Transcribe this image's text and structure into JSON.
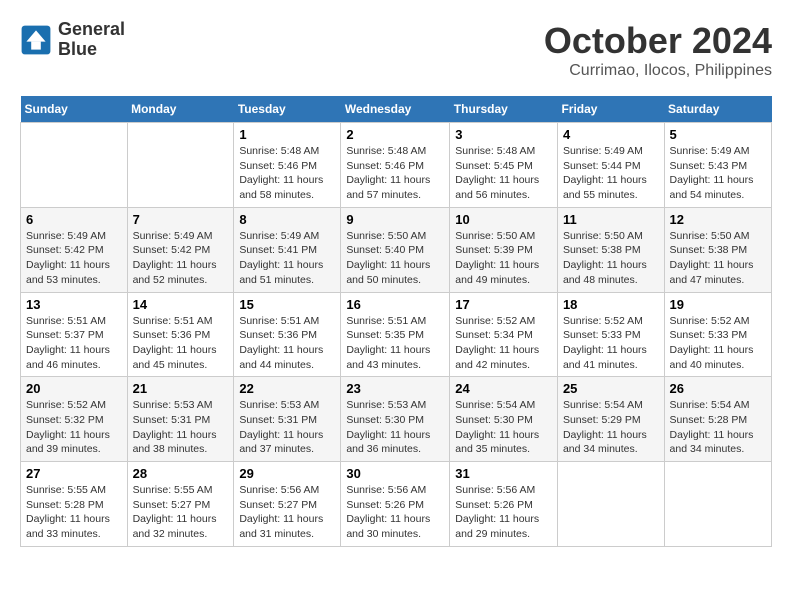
{
  "logo": {
    "line1": "General",
    "line2": "Blue"
  },
  "title": "October 2024",
  "subtitle": "Currimao, Ilocos, Philippines",
  "weekdays": [
    "Sunday",
    "Monday",
    "Tuesday",
    "Wednesday",
    "Thursday",
    "Friday",
    "Saturday"
  ],
  "weeks": [
    [
      {
        "day": "",
        "sunrise": "",
        "sunset": "",
        "daylight": ""
      },
      {
        "day": "",
        "sunrise": "",
        "sunset": "",
        "daylight": ""
      },
      {
        "day": "1",
        "sunrise": "Sunrise: 5:48 AM",
        "sunset": "Sunset: 5:46 PM",
        "daylight": "Daylight: 11 hours and 58 minutes."
      },
      {
        "day": "2",
        "sunrise": "Sunrise: 5:48 AM",
        "sunset": "Sunset: 5:46 PM",
        "daylight": "Daylight: 11 hours and 57 minutes."
      },
      {
        "day": "3",
        "sunrise": "Sunrise: 5:48 AM",
        "sunset": "Sunset: 5:45 PM",
        "daylight": "Daylight: 11 hours and 56 minutes."
      },
      {
        "day": "4",
        "sunrise": "Sunrise: 5:49 AM",
        "sunset": "Sunset: 5:44 PM",
        "daylight": "Daylight: 11 hours and 55 minutes."
      },
      {
        "day": "5",
        "sunrise": "Sunrise: 5:49 AM",
        "sunset": "Sunset: 5:43 PM",
        "daylight": "Daylight: 11 hours and 54 minutes."
      }
    ],
    [
      {
        "day": "6",
        "sunrise": "Sunrise: 5:49 AM",
        "sunset": "Sunset: 5:42 PM",
        "daylight": "Daylight: 11 hours and 53 minutes."
      },
      {
        "day": "7",
        "sunrise": "Sunrise: 5:49 AM",
        "sunset": "Sunset: 5:42 PM",
        "daylight": "Daylight: 11 hours and 52 minutes."
      },
      {
        "day": "8",
        "sunrise": "Sunrise: 5:49 AM",
        "sunset": "Sunset: 5:41 PM",
        "daylight": "Daylight: 11 hours and 51 minutes."
      },
      {
        "day": "9",
        "sunrise": "Sunrise: 5:50 AM",
        "sunset": "Sunset: 5:40 PM",
        "daylight": "Daylight: 11 hours and 50 minutes."
      },
      {
        "day": "10",
        "sunrise": "Sunrise: 5:50 AM",
        "sunset": "Sunset: 5:39 PM",
        "daylight": "Daylight: 11 hours and 49 minutes."
      },
      {
        "day": "11",
        "sunrise": "Sunrise: 5:50 AM",
        "sunset": "Sunset: 5:38 PM",
        "daylight": "Daylight: 11 hours and 48 minutes."
      },
      {
        "day": "12",
        "sunrise": "Sunrise: 5:50 AM",
        "sunset": "Sunset: 5:38 PM",
        "daylight": "Daylight: 11 hours and 47 minutes."
      }
    ],
    [
      {
        "day": "13",
        "sunrise": "Sunrise: 5:51 AM",
        "sunset": "Sunset: 5:37 PM",
        "daylight": "Daylight: 11 hours and 46 minutes."
      },
      {
        "day": "14",
        "sunrise": "Sunrise: 5:51 AM",
        "sunset": "Sunset: 5:36 PM",
        "daylight": "Daylight: 11 hours and 45 minutes."
      },
      {
        "day": "15",
        "sunrise": "Sunrise: 5:51 AM",
        "sunset": "Sunset: 5:36 PM",
        "daylight": "Daylight: 11 hours and 44 minutes."
      },
      {
        "day": "16",
        "sunrise": "Sunrise: 5:51 AM",
        "sunset": "Sunset: 5:35 PM",
        "daylight": "Daylight: 11 hours and 43 minutes."
      },
      {
        "day": "17",
        "sunrise": "Sunrise: 5:52 AM",
        "sunset": "Sunset: 5:34 PM",
        "daylight": "Daylight: 11 hours and 42 minutes."
      },
      {
        "day": "18",
        "sunrise": "Sunrise: 5:52 AM",
        "sunset": "Sunset: 5:33 PM",
        "daylight": "Daylight: 11 hours and 41 minutes."
      },
      {
        "day": "19",
        "sunrise": "Sunrise: 5:52 AM",
        "sunset": "Sunset: 5:33 PM",
        "daylight": "Daylight: 11 hours and 40 minutes."
      }
    ],
    [
      {
        "day": "20",
        "sunrise": "Sunrise: 5:52 AM",
        "sunset": "Sunset: 5:32 PM",
        "daylight": "Daylight: 11 hours and 39 minutes."
      },
      {
        "day": "21",
        "sunrise": "Sunrise: 5:53 AM",
        "sunset": "Sunset: 5:31 PM",
        "daylight": "Daylight: 11 hours and 38 minutes."
      },
      {
        "day": "22",
        "sunrise": "Sunrise: 5:53 AM",
        "sunset": "Sunset: 5:31 PM",
        "daylight": "Daylight: 11 hours and 37 minutes."
      },
      {
        "day": "23",
        "sunrise": "Sunrise: 5:53 AM",
        "sunset": "Sunset: 5:30 PM",
        "daylight": "Daylight: 11 hours and 36 minutes."
      },
      {
        "day": "24",
        "sunrise": "Sunrise: 5:54 AM",
        "sunset": "Sunset: 5:30 PM",
        "daylight": "Daylight: 11 hours and 35 minutes."
      },
      {
        "day": "25",
        "sunrise": "Sunrise: 5:54 AM",
        "sunset": "Sunset: 5:29 PM",
        "daylight": "Daylight: 11 hours and 34 minutes."
      },
      {
        "day": "26",
        "sunrise": "Sunrise: 5:54 AM",
        "sunset": "Sunset: 5:28 PM",
        "daylight": "Daylight: 11 hours and 34 minutes."
      }
    ],
    [
      {
        "day": "27",
        "sunrise": "Sunrise: 5:55 AM",
        "sunset": "Sunset: 5:28 PM",
        "daylight": "Daylight: 11 hours and 33 minutes."
      },
      {
        "day": "28",
        "sunrise": "Sunrise: 5:55 AM",
        "sunset": "Sunset: 5:27 PM",
        "daylight": "Daylight: 11 hours and 32 minutes."
      },
      {
        "day": "29",
        "sunrise": "Sunrise: 5:56 AM",
        "sunset": "Sunset: 5:27 PM",
        "daylight": "Daylight: 11 hours and 31 minutes."
      },
      {
        "day": "30",
        "sunrise": "Sunrise: 5:56 AM",
        "sunset": "Sunset: 5:26 PM",
        "daylight": "Daylight: 11 hours and 30 minutes."
      },
      {
        "day": "31",
        "sunrise": "Sunrise: 5:56 AM",
        "sunset": "Sunset: 5:26 PM",
        "daylight": "Daylight: 11 hours and 29 minutes."
      },
      {
        "day": "",
        "sunrise": "",
        "sunset": "",
        "daylight": ""
      },
      {
        "day": "",
        "sunrise": "",
        "sunset": "",
        "daylight": ""
      }
    ]
  ]
}
